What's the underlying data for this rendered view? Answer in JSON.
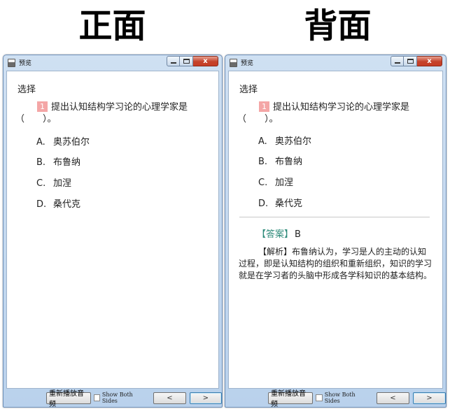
{
  "titles": {
    "front": "正面",
    "back": "背面"
  },
  "window": {
    "title": "预览",
    "close_glyph": "x"
  },
  "question": {
    "type": "选择",
    "number": "1",
    "stem": "提出认知结构学习论的心理学家是",
    "paren": "（　　）。",
    "options": [
      {
        "letter": "A.",
        "text": "奥苏伯尔"
      },
      {
        "letter": "B.",
        "text": "布鲁纳"
      },
      {
        "letter": "C.",
        "text": "加涅"
      },
      {
        "letter": "D.",
        "text": "桑代克"
      }
    ]
  },
  "answer": {
    "label": "【答案】",
    "value": "B",
    "explanation": "【解析】布鲁纳认为，学习是人的主动的认知过程，即是认知结构的组织和重新组织，知识的学习就是在学习者的头脑中形成各学科知识的基本结构。"
  },
  "controls": {
    "replay": "重新播放音频",
    "show_both": "Show Both Sides",
    "prev": "<",
    "next": ">"
  }
}
